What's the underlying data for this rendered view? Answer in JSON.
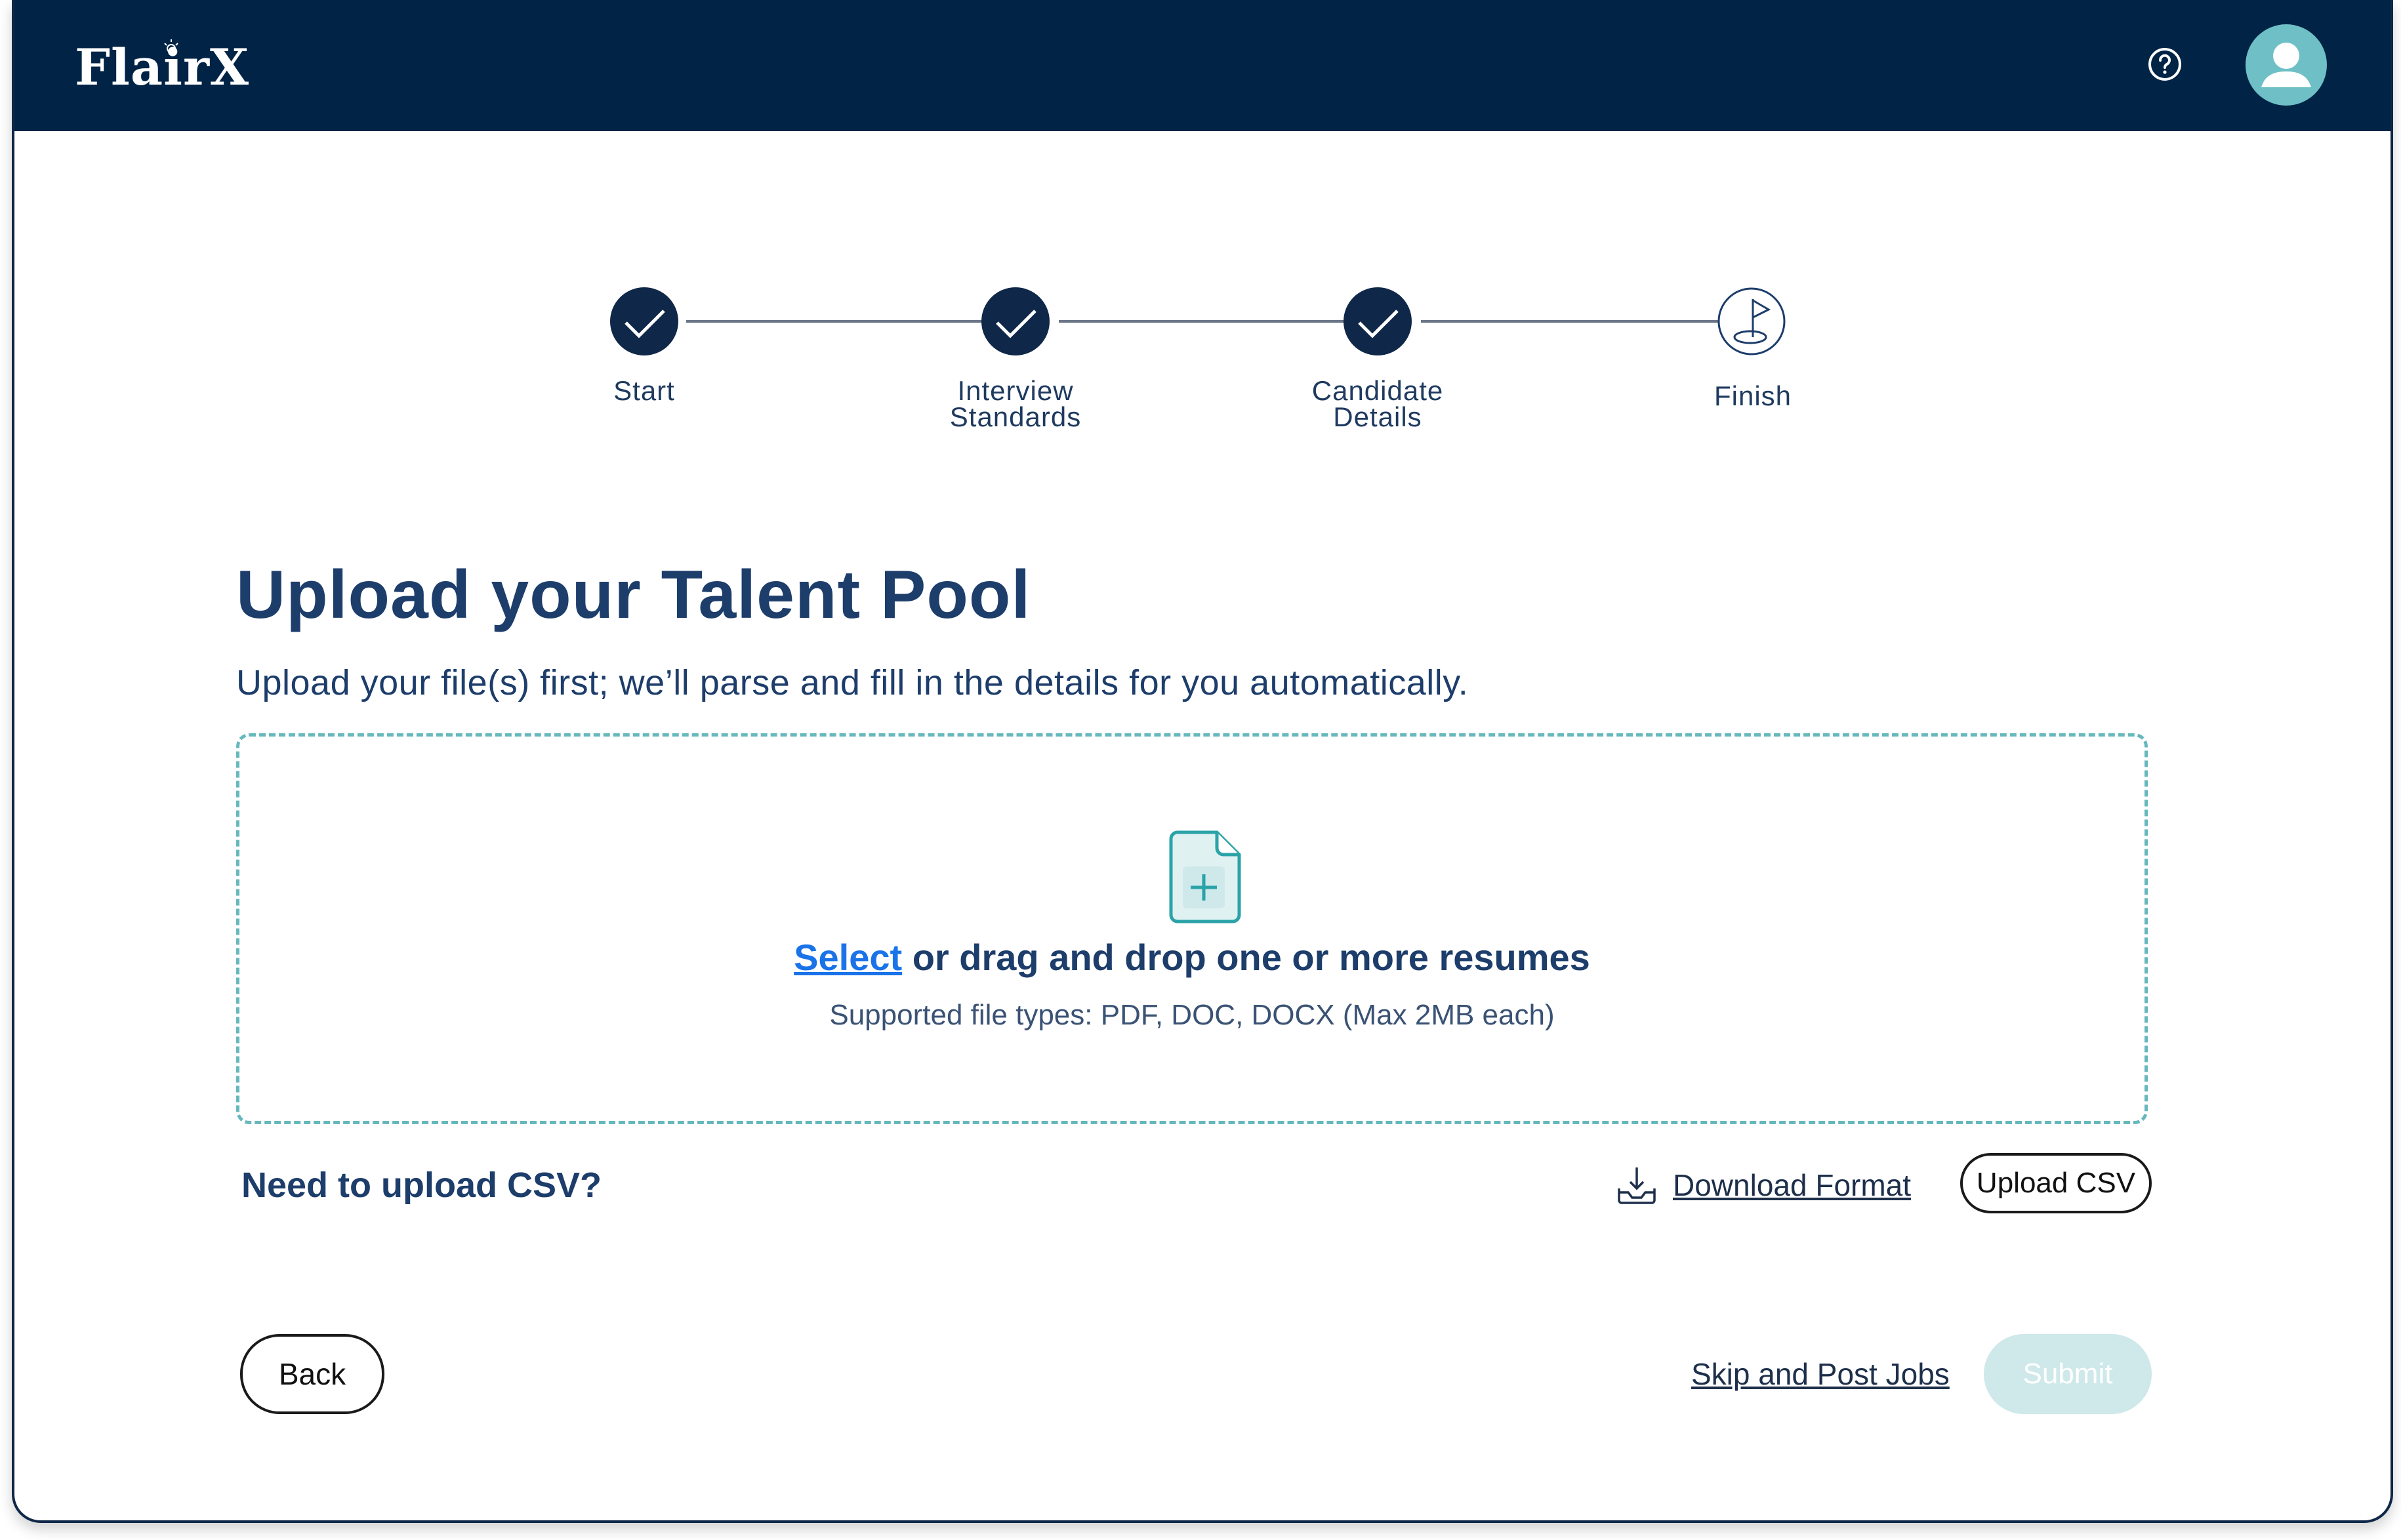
{
  "brand": {
    "name": "FlairX"
  },
  "header": {
    "help_icon": "question-circle-icon",
    "avatar_icon": "user-avatar-icon"
  },
  "stepper": {
    "steps": [
      {
        "label_line1": "Start",
        "label_line2": "",
        "status": "completed"
      },
      {
        "label_line1": "Interview",
        "label_line2": "Standards",
        "status": "completed"
      },
      {
        "label_line1": "Candidate",
        "label_line2": "Details",
        "status": "completed"
      },
      {
        "label_line1": "Finish",
        "label_line2": "",
        "status": "current"
      }
    ]
  },
  "main": {
    "title": "Upload your Talent Pool",
    "subtitle": "Upload your file(s) first; we’ll parse and fill in the details for you automatically."
  },
  "dropzone": {
    "select_label": "Select",
    "instruction": " or drag and drop one or more resumes",
    "hint": "Supported file types: PDF, DOC, DOCX (Max 2MB each)"
  },
  "csv": {
    "question": "Need to upload CSV?",
    "download_label": "Download Format",
    "upload_label": "Upload CSV"
  },
  "footer": {
    "back_label": "Back",
    "skip_label": "Skip and Post Jobs",
    "submit_label": "Submit"
  },
  "colors": {
    "navy": "#002346",
    "heading": "#1d3d6b",
    "accent_teal": "#66b8bd",
    "link_blue": "#1a73e8",
    "submit_disabled": "#cfe8ea"
  }
}
